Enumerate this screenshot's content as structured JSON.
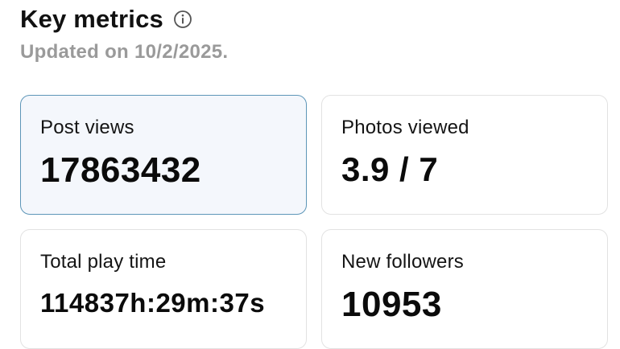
{
  "header": {
    "title": "Key metrics",
    "info_icon": "info-circle-icon",
    "updated": "Updated on 10/2/2025."
  },
  "colors": {
    "selected_background": "#f4f7fc",
    "selected_border": "#5d96b8",
    "card_border": "#e2e2e2",
    "subtitle": "#9a9a9a"
  },
  "metrics": [
    {
      "label": "Post views",
      "value": "17863432",
      "selected": true
    },
    {
      "label": "Photos viewed",
      "value": "3.9 / 7",
      "selected": false
    },
    {
      "label": "Total play time",
      "value": "114837h:29m:37s",
      "selected": false
    },
    {
      "label": "New followers",
      "value": "10953",
      "selected": false
    }
  ]
}
